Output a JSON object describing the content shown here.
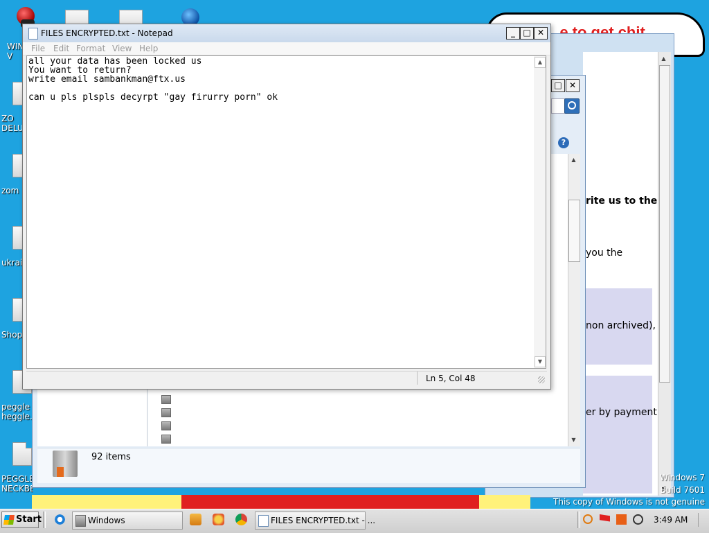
{
  "desktop": {
    "icons": [
      {
        "label": "WIN\nV"
      },
      {
        "label": "ZO\nDELU"
      },
      {
        "label": "zom"
      },
      {
        "label": "ukrai"
      },
      {
        "label": "Shop"
      },
      {
        "label": "peggle\nheggle.t"
      },
      {
        "label": "PEGGLE\nNECKBE"
      }
    ]
  },
  "banner": {
    "text": "...e to get chit"
  },
  "explorer": {
    "status_items": "92 items"
  },
  "ransom_note_fragments": {
    "line1": "rite us to the",
    "line2": "you the",
    "line3": "non archived),",
    "line4": "er by payment"
  },
  "notepad": {
    "title": "FILES ENCRYPTED.txt - Notepad",
    "menu": [
      "File",
      "Edit",
      "Format",
      "View",
      "Help"
    ],
    "content": "all your data has been locked us\nYou want to return?\nwrite email sambankman@ftx.us\n\ncan u pls plspls decyrpt \"gay firurry porn\" ok",
    "status": "Ln 5, Col 48"
  },
  "watermark": {
    "line1": "Windows 7",
    "line2": "Build 7601",
    "line3": "This copy of Windows is not genuine"
  },
  "taskbar": {
    "start_label": "Start",
    "tasks": [
      {
        "label": "Windows"
      },
      {
        "label": "FILES ENCRYPTED.txt - ..."
      }
    ],
    "clock": "3:49 AM"
  }
}
